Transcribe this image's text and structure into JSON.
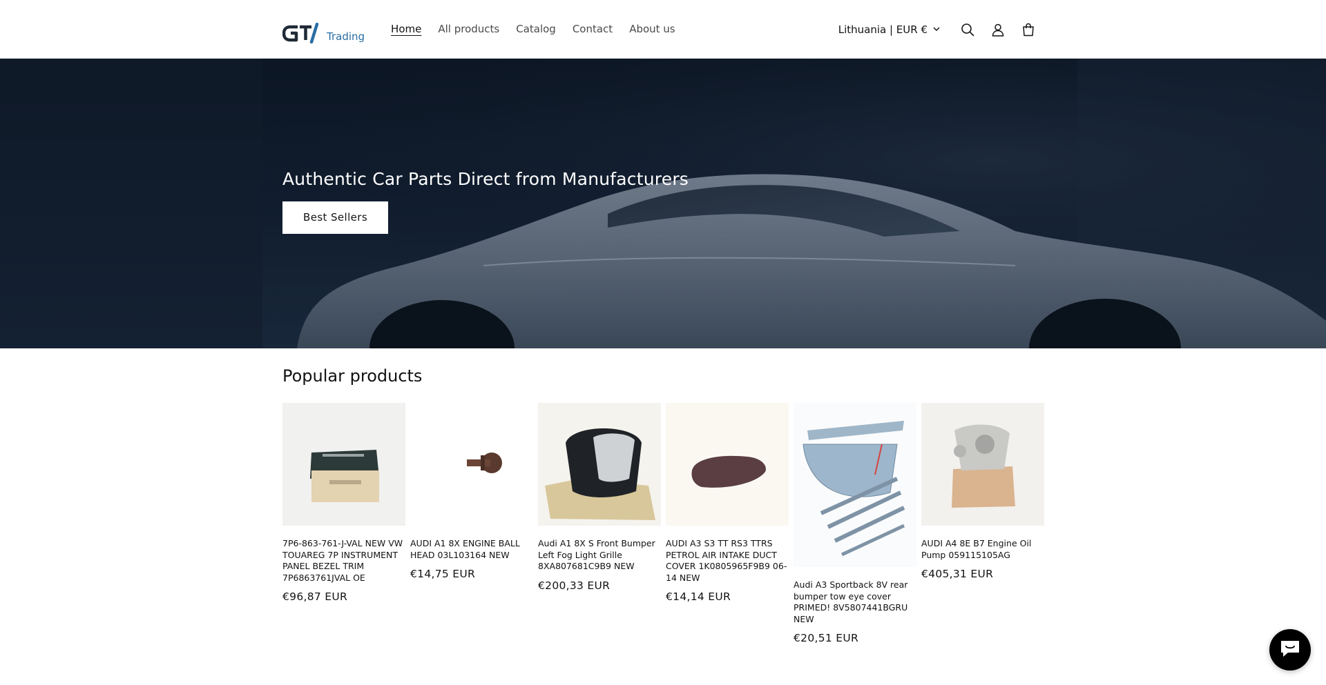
{
  "brand": {
    "logo_text": "Trading",
    "logo_mark_label": "GT"
  },
  "nav": {
    "items": [
      {
        "label": "Home",
        "active": true
      },
      {
        "label": "All products"
      },
      {
        "label": "Catalog"
      },
      {
        "label": "Contact"
      },
      {
        "label": "About us"
      }
    ]
  },
  "header": {
    "locale": "Lithuania | EUR €"
  },
  "hero": {
    "title": "Authentic Car Parts Direct from Manufacturers",
    "button": "Best Sellers"
  },
  "products": {
    "title": "Popular products",
    "items": [
      {
        "title": "7P6-863-761-J-VAL NEW VW TOUAREG 7P INSTRUMENT PANEL BEZEL TRIM 7P6863761JVAL OE",
        "price": "€96,87 EUR"
      },
      {
        "title": "AUDI A1 8X ENGINE BALL HEAD 03L103164 NEW",
        "price": "€14,75 EUR"
      },
      {
        "title": "Audi A1 8X S Front Bumper Left Fog Light Grille 8XA807681C9B9 NEW",
        "price": "€200,33 EUR"
      },
      {
        "title": "AUDI A3 S3 TT RS3 TTRS PETROL AIR INTAKE DUCT COVER 1K0805965F9B9 06-14 NEW",
        "price": "€14,14 EUR"
      },
      {
        "title": "Audi A3 Sportback 8V rear bumper tow eye cover PRIMED! 8V5807441BGRU NEW",
        "price": "€20,51 EUR"
      },
      {
        "title": "AUDI A4 8E B7 Engine Oil Pump 059115105AG",
        "price": "€405,31 EUR"
      }
    ]
  },
  "colors": {
    "accent": "#2a6ea3",
    "hero_bg": "#0f1a2a",
    "text": "#121212"
  }
}
